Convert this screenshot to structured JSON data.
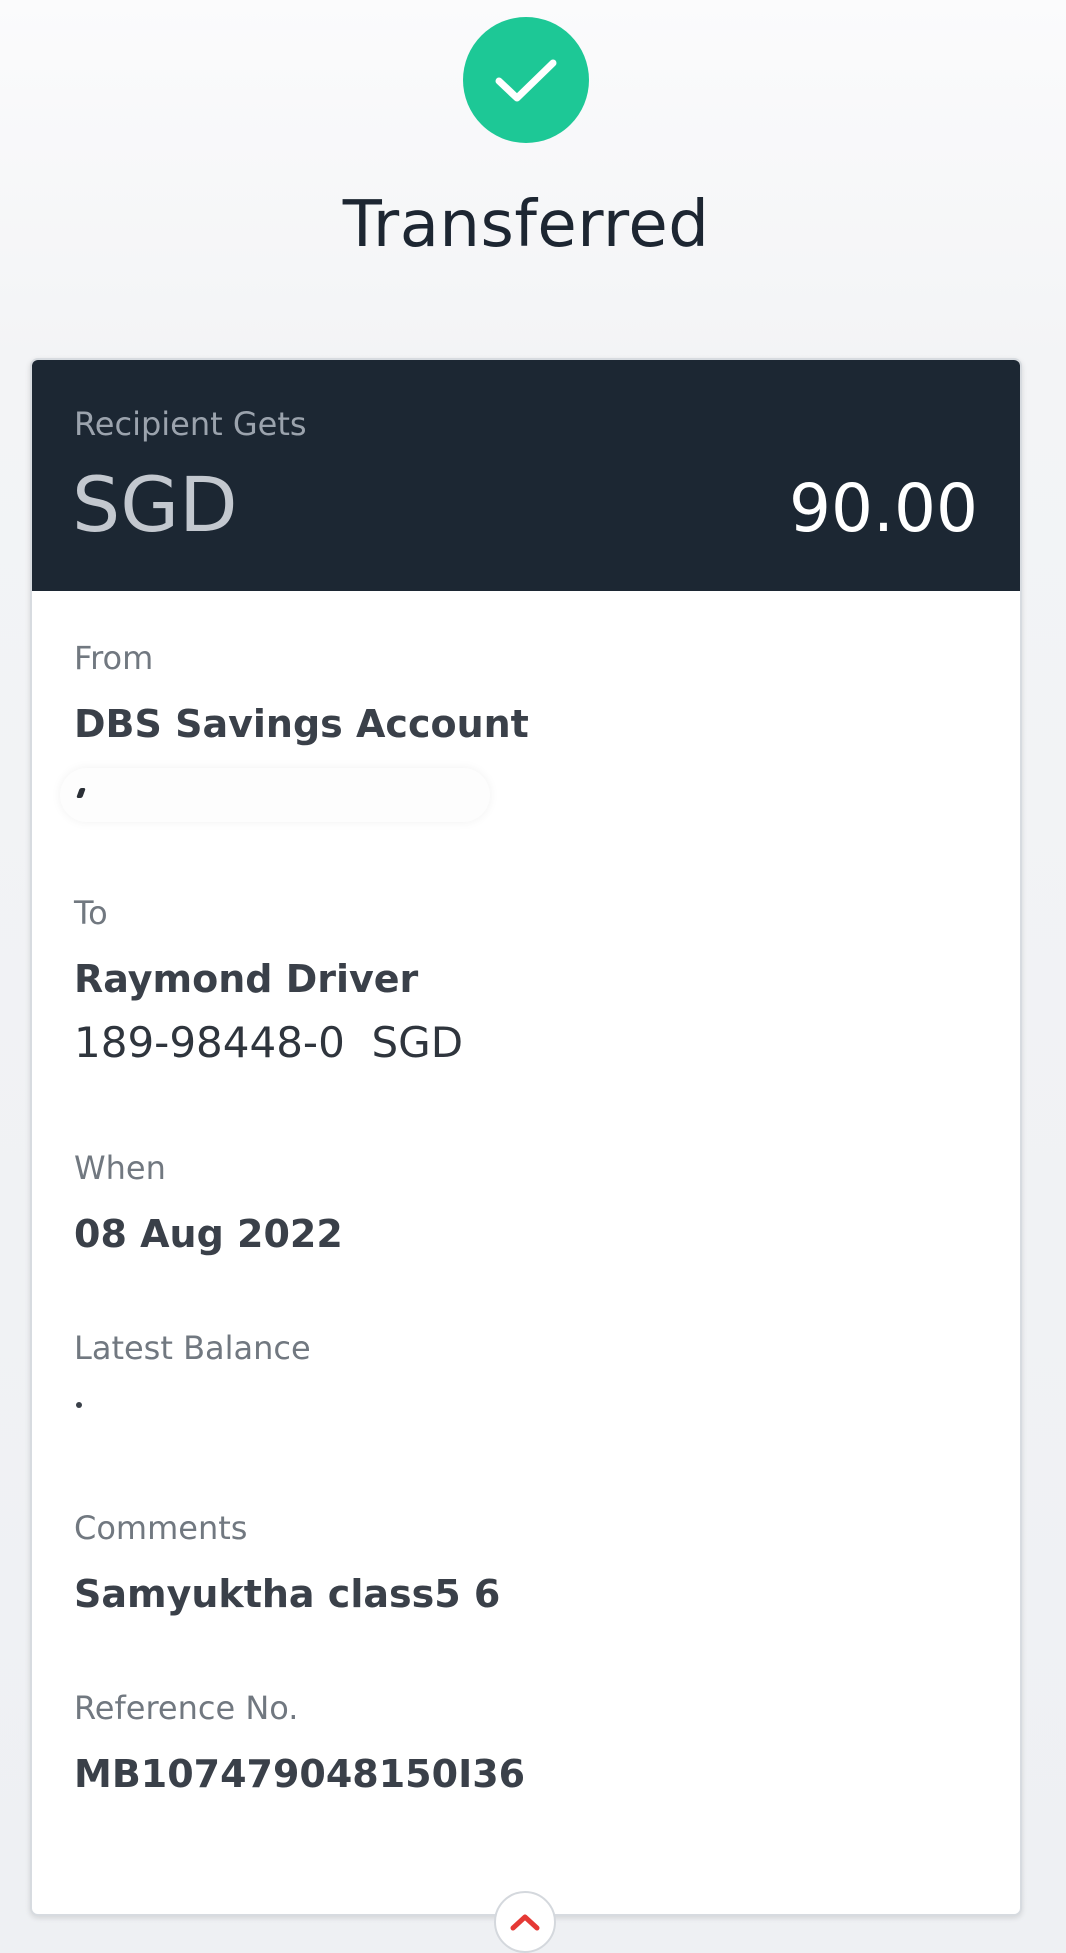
{
  "status": {
    "title": "Transferred",
    "icon": "check-icon",
    "color": "#1dc896"
  },
  "recipient": {
    "label": "Recipient Gets",
    "currency": "SGD",
    "amount": "90.00"
  },
  "from": {
    "label": "From",
    "account": "DBS Savings Account"
  },
  "to": {
    "label": "To",
    "name": "Raymond Driver",
    "account": "189-98448-0  SGD"
  },
  "when": {
    "label": "When",
    "date": "08 Aug 2022"
  },
  "balance": {
    "label": "Latest Balance"
  },
  "comments": {
    "label": "Comments",
    "value": "Samyuktha class5 6"
  },
  "reference": {
    "label": "Reference No.",
    "value": "MB107479048150I36"
  },
  "footer": {
    "collapse_icon": "chevron-up-icon"
  }
}
